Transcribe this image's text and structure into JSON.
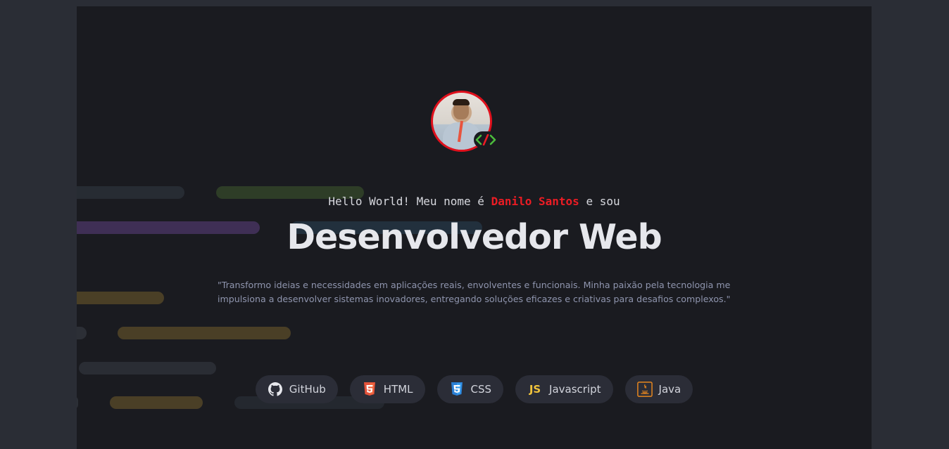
{
  "hero": {
    "greeting_prefix": "Hello World! Meu nome é",
    "name": "Danilo Santos",
    "greeting_suffix": "e sou",
    "title": "Desenvolvedor Web",
    "quote": "\"Transformo ideias e necessidades em aplicações reais, envolventes e funcionais. Minha paixão pela tecnologia me impulsiona a desenvolver sistemas inovadores, entregando soluções eficazes e criativas para desafios complexos.\""
  },
  "avatar": {
    "badge_icon": "code-icon"
  },
  "skills": [
    {
      "label": "GitHub",
      "icon": "github-icon"
    },
    {
      "label": "HTML",
      "icon": "html5-icon"
    },
    {
      "label": "CSS",
      "icon": "css3-icon"
    },
    {
      "label": "Javascript",
      "icon": "js-icon",
      "icon_text": "JS"
    },
    {
      "label": "Java",
      "icon": "java-icon"
    }
  ],
  "colors": {
    "accent": "#ec1c24",
    "background": "#1a1b20",
    "outer_background": "#2a2d35",
    "chip_background": "#2b2d37"
  }
}
